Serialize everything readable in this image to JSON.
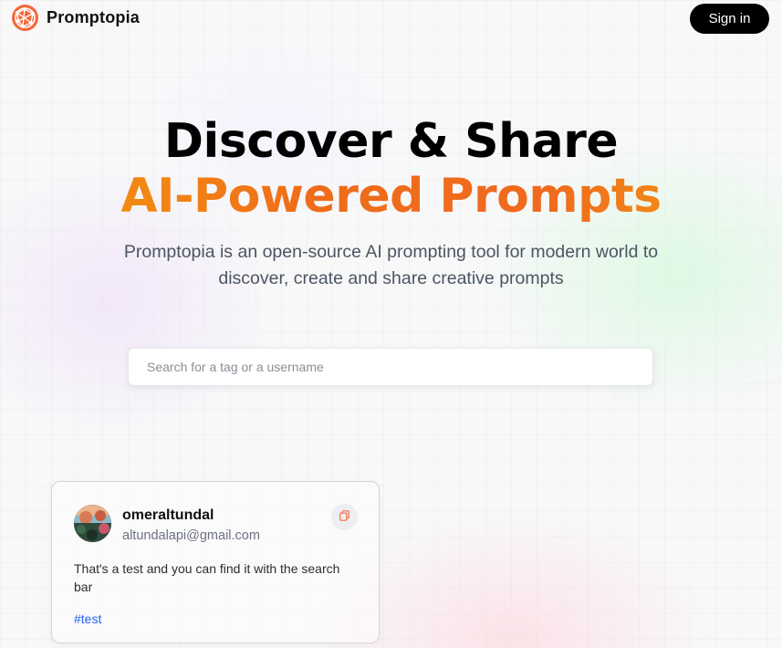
{
  "nav": {
    "brand": "Promptopia",
    "logo_icon": "globe-network-icon",
    "signin_label": "Sign in"
  },
  "hero": {
    "line1": "Discover & Share",
    "line2": "AI-Powered Prompts",
    "description": "Promptopia is an open-source AI prompting tool for modern world to discover, create and share creative prompts"
  },
  "search": {
    "placeholder": "Search for a tag or a username",
    "value": ""
  },
  "posts": [
    {
      "username": "omeraltundal",
      "email": "altundalapi@gmail.com",
      "prompt": "That's a test and you can find it with the search bar",
      "tag": "#test",
      "copy_icon": "copy-icon"
    }
  ],
  "colors": {
    "accent_orange": "#f06a1e",
    "accent_amber": "#f59e0b",
    "tag_blue": "#2563eb",
    "button_black": "#000000"
  }
}
